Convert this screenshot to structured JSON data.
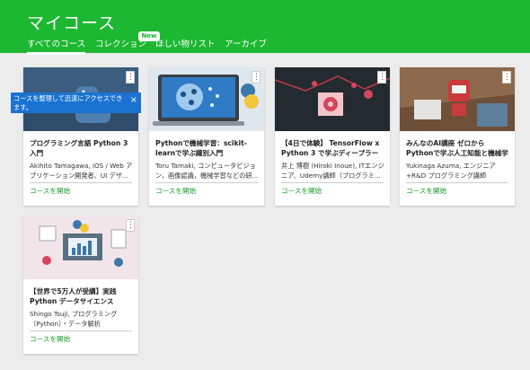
{
  "header": {
    "title": "マイコース",
    "tabs": [
      {
        "label": "すべてのコース",
        "active": true
      },
      {
        "label": "コレクション",
        "active": false
      },
      {
        "label": "ほしい物リスト",
        "active": false
      },
      {
        "label": "アーカイブ",
        "active": false
      }
    ],
    "new_badge": "New",
    "accent_color": "#1db832"
  },
  "tooltip": {
    "text": "コースを整理して迅速にアクセスできます。",
    "close_icon": "×"
  },
  "courses": [
    {
      "title": "プログラミング言語 Python 3 入門",
      "author": "Akihito Tamagawa, iOS / Web アプリケーション開発者、UI デザ...",
      "action": "コースを開始",
      "menu_icon": "⋮"
    },
    {
      "title": "Pythonで機械学習：scikit-learnで学ぶ識別入門",
      "author": "Toru Tamaki, コンピュータビジョン，画像認識，機械学習などの研...",
      "action": "コースを開始",
      "menu_icon": "⋮"
    },
    {
      "title": "【4日で体験】 TensorFlow x Python 3 で学ぶディープラーニ...",
      "author": "井上 博樹 (Hiroki Inoue), ITエンジニア、Udemy講師（プログラミ...",
      "action": "コースを開始",
      "menu_icon": "⋮"
    },
    {
      "title": "みんなのAI講座 ゼロからPythonで学ぶ人工知能と機械学習",
      "author": "Yukinaga Azuma, エンジニア +R&D プログラミング講師",
      "action": "コースを開始",
      "menu_icon": "⋮"
    },
    {
      "title": "【世界で5万人が受講】実践 Python データサイエンス",
      "author": "Shingo Tsuji, プログラミング（Python）・データ解析",
      "action": "コースを開始",
      "menu_icon": "⋮"
    }
  ]
}
